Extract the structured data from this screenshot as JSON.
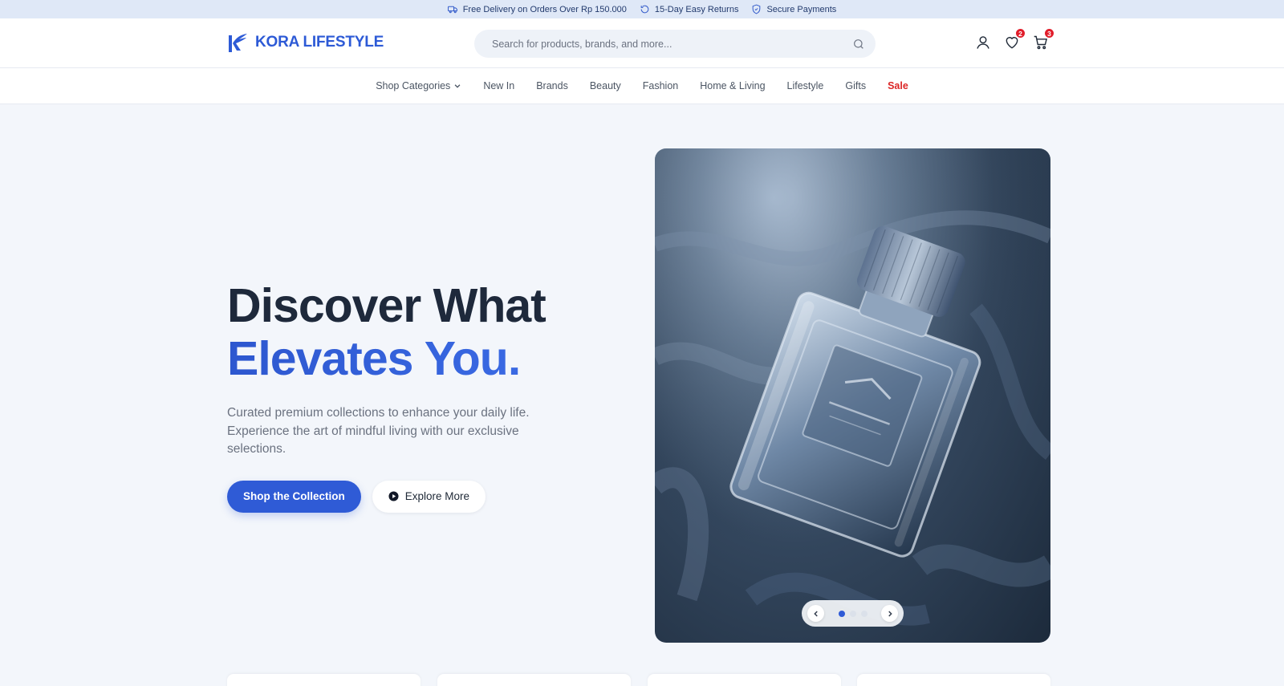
{
  "topbar": {
    "perks": [
      {
        "icon": "truck-icon",
        "label": "Free Delivery on Orders Over Rp 150.000"
      },
      {
        "icon": "return-icon",
        "label": "15-Day Easy Returns"
      },
      {
        "icon": "shield-icon",
        "label": "Secure Payments"
      }
    ]
  },
  "header": {
    "brand": "KORA LIFESTYLE",
    "search_placeholder": "Search for products, brands, and more...",
    "wishlist_count": "2",
    "cart_count": "3"
  },
  "nav": {
    "items": [
      {
        "label": "Shop Categories",
        "dropdown": true
      },
      {
        "label": "New In"
      },
      {
        "label": "Brands"
      },
      {
        "label": "Beauty"
      },
      {
        "label": "Fashion"
      },
      {
        "label": "Home & Living"
      },
      {
        "label": "Lifestyle"
      },
      {
        "label": "Gifts"
      },
      {
        "label": "Sale",
        "highlight": "#dc2626"
      }
    ]
  },
  "hero": {
    "headline_line1": "Discover What",
    "headline_line2": "Elevates You.",
    "subcopy": "Curated premium collections to enhance your daily life. Experience the art of mindful living with our exclusive selections.",
    "primary_cta": "Shop the Collection",
    "secondary_cta": "Explore More",
    "slider": {
      "total": 3,
      "active": 1
    }
  },
  "colors": {
    "accent": "#2f5bd6",
    "sale": "#dc2626",
    "badge": "#e11d2a",
    "topbar_bg": "#dfe8f7",
    "page_bg": "#f3f6fb"
  }
}
